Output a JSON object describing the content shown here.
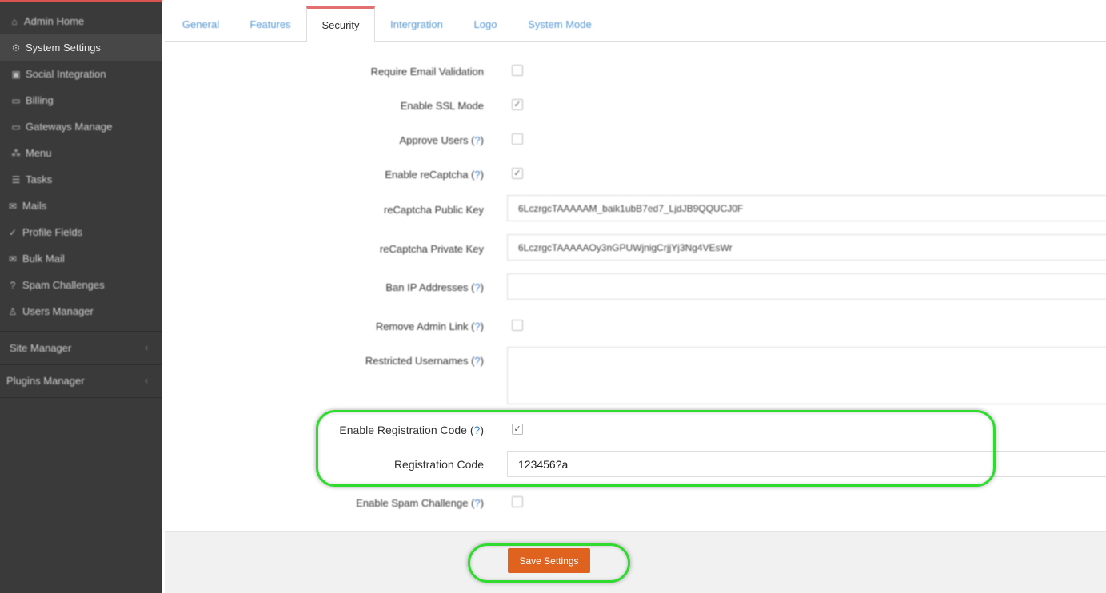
{
  "sidebar": {
    "items": [
      {
        "label": "Admin Home",
        "icon": "home-icon",
        "glyph": "⌂"
      },
      {
        "label": "System Settings",
        "icon": "gear-icon",
        "glyph": "⚙"
      },
      {
        "label": "Social Integration",
        "icon": "social-icon",
        "glyph": "▣"
      },
      {
        "label": "Billing",
        "icon": "card-icon",
        "glyph": "▭"
      },
      {
        "label": "Gateways Manage",
        "icon": "card-icon",
        "glyph": "▭"
      },
      {
        "label": "Menu",
        "icon": "sitemap-icon",
        "glyph": "⁂"
      },
      {
        "label": "Tasks",
        "icon": "list-icon",
        "glyph": "☰"
      },
      {
        "label": "Mails",
        "icon": "mail-icon",
        "glyph": "✉"
      },
      {
        "label": "Profile Fields",
        "icon": "check-circle-icon",
        "glyph": "✓"
      },
      {
        "label": "Bulk Mail",
        "icon": "mail-icon",
        "glyph": "✉"
      },
      {
        "label": "Spam Challenges",
        "icon": "question-circle-icon",
        "glyph": "?"
      },
      {
        "label": "Users Manager",
        "icon": "user-icon",
        "glyph": "♙"
      }
    ],
    "groups": [
      {
        "label": "Site Manager"
      },
      {
        "label": "Plugins Manager"
      }
    ]
  },
  "tabs": [
    "General",
    "Features",
    "Security",
    "Intergration",
    "Logo",
    "System Mode"
  ],
  "form": {
    "help_mark": "?",
    "require_email_validation": {
      "label": "Require Email Validation",
      "checked": false
    },
    "enable_ssl": {
      "label": "Enable SSL Mode",
      "checked": true
    },
    "approve_users": {
      "label": "Approve Users",
      "checked": false
    },
    "enable_recaptcha": {
      "label": "Enable reCaptcha",
      "checked": true
    },
    "recaptcha_public": {
      "label": "reCaptcha Public Key",
      "value": "6LczrgcTAAAAAM_baik1ubB7ed7_LjdJB9QQUCJ0F"
    },
    "recaptcha_private": {
      "label": "reCaptcha Private Key",
      "value": "6LczrgcTAAAAAOy3nGPUWjnigCrjjYj3Ng4VEsWr"
    },
    "ban_ip": {
      "label": "Ban IP Addresses",
      "value": ""
    },
    "remove_admin_link": {
      "label": "Remove Admin Link",
      "checked": false
    },
    "restricted_usernames": {
      "label": "Restricted Usernames",
      "value": ""
    },
    "enable_registration_code": {
      "label": "Enable Registration Code",
      "checked": true
    },
    "registration_code": {
      "label": "Registration Code",
      "value": "123456?a"
    },
    "enable_spam_challenge": {
      "label": "Enable Spam Challenge",
      "checked": false
    }
  },
  "footer": {
    "save_label": "Save Settings"
  },
  "colors": {
    "highlight": "#2edb2e",
    "save_button": "#e0621f",
    "active_tab_border": "#e36f6f"
  }
}
